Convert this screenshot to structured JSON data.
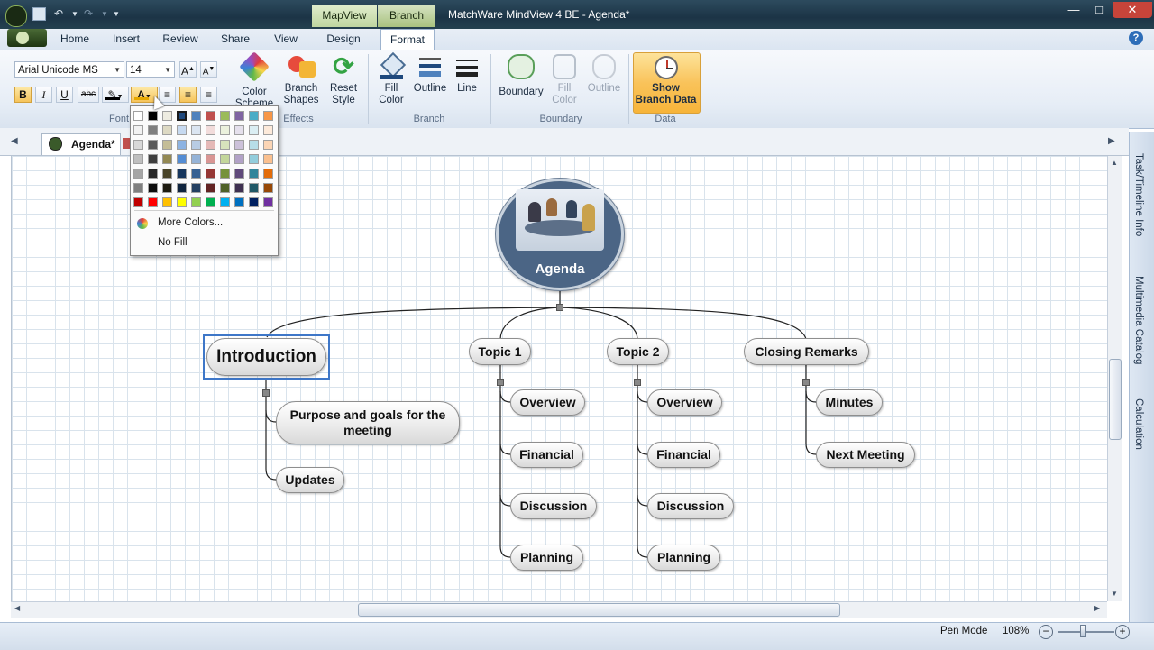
{
  "window": {
    "title": "MatchWare MindView 4 BE - Agenda*",
    "context_tabs": [
      "MapView",
      "Branch"
    ]
  },
  "menu": {
    "tabs": [
      "Home",
      "Insert",
      "Review",
      "Share",
      "View",
      "Design",
      "Format"
    ],
    "active": "Format"
  },
  "ribbon": {
    "font_name": "Arial Unicode MS",
    "font_size": "14",
    "font_group": "Font",
    "bold": "B",
    "italic": "I",
    "underline": "U",
    "strike": "abc",
    "effects_group": "Effects",
    "color_scheme": "Color Scheme",
    "branch_shapes": "Branch Shapes",
    "reset_style": "Reset Style",
    "branch_group": "Branch",
    "fill_color": "Fill Color",
    "outline": "Outline",
    "line": "Line",
    "boundary_group": "Boundary",
    "boundary": "Boundary",
    "b_fill_color": "Fill Color",
    "b_outline": "Outline",
    "data_group": "Data",
    "show_branch_data": "Show Branch Data"
  },
  "color_menu": {
    "more_colors": "More Colors...",
    "no_fill": "No Fill",
    "rows": [
      [
        "#ffffff",
        "#000000",
        "#eeece1",
        "#1f497d",
        "#4f81bd",
        "#c0504d",
        "#9bbb59",
        "#8064a2",
        "#4bacc6",
        "#f79646"
      ],
      [
        "#f2f2f2",
        "#7f7f7f",
        "#ddd9c3",
        "#c6d9f0",
        "#dbe5f1",
        "#f2dcdb",
        "#ebf1dd",
        "#e5e0ec",
        "#dbeef3",
        "#fdeada"
      ],
      [
        "#d8d8d8",
        "#595959",
        "#c4bd97",
        "#8db3e2",
        "#b8cce4",
        "#e5b9b7",
        "#d7e3bc",
        "#ccc1d9",
        "#b7dde8",
        "#fbd5b5"
      ],
      [
        "#bfbfbf",
        "#3f3f3f",
        "#938953",
        "#548dd4",
        "#95b3d7",
        "#d99694",
        "#c3d69b",
        "#b2a2c7",
        "#92cddc",
        "#fac08f"
      ],
      [
        "#a5a5a5",
        "#262626",
        "#494429",
        "#17365d",
        "#366092",
        "#953734",
        "#76923c",
        "#5f497a",
        "#31859b",
        "#e36c09"
      ],
      [
        "#7f7f7f",
        "#0c0c0c",
        "#1d1b10",
        "#0f243e",
        "#244061",
        "#632423",
        "#4f6128",
        "#3f3151",
        "#205867",
        "#974806"
      ],
      [
        "#c00000",
        "#ff0000",
        "#ffc000",
        "#ffff00",
        "#92d050",
        "#00b050",
        "#00b0f0",
        "#0070c0",
        "#002060",
        "#7030a0"
      ]
    ]
  },
  "document_tab": "Agenda*",
  "map": {
    "root": "Agenda",
    "branches": [
      {
        "label": "Introduction",
        "children": [
          "Purpose and goals for the meeting",
          "Updates"
        ]
      },
      {
        "label": "Topic 1",
        "children": [
          "Overview",
          "Financial",
          "Discussion",
          "Planning"
        ]
      },
      {
        "label": "Topic 2",
        "children": [
          "Overview",
          "Financial",
          "Discussion",
          "Planning"
        ]
      },
      {
        "label": "Closing Remarks",
        "children": [
          "Minutes",
          "Next Meeting"
        ]
      }
    ]
  },
  "side_panel": [
    "Task/Timeline Info",
    "Multimedia Catalog",
    "Calculation"
  ],
  "status": {
    "pen_mode": "Pen Mode",
    "zoom": "108%"
  }
}
